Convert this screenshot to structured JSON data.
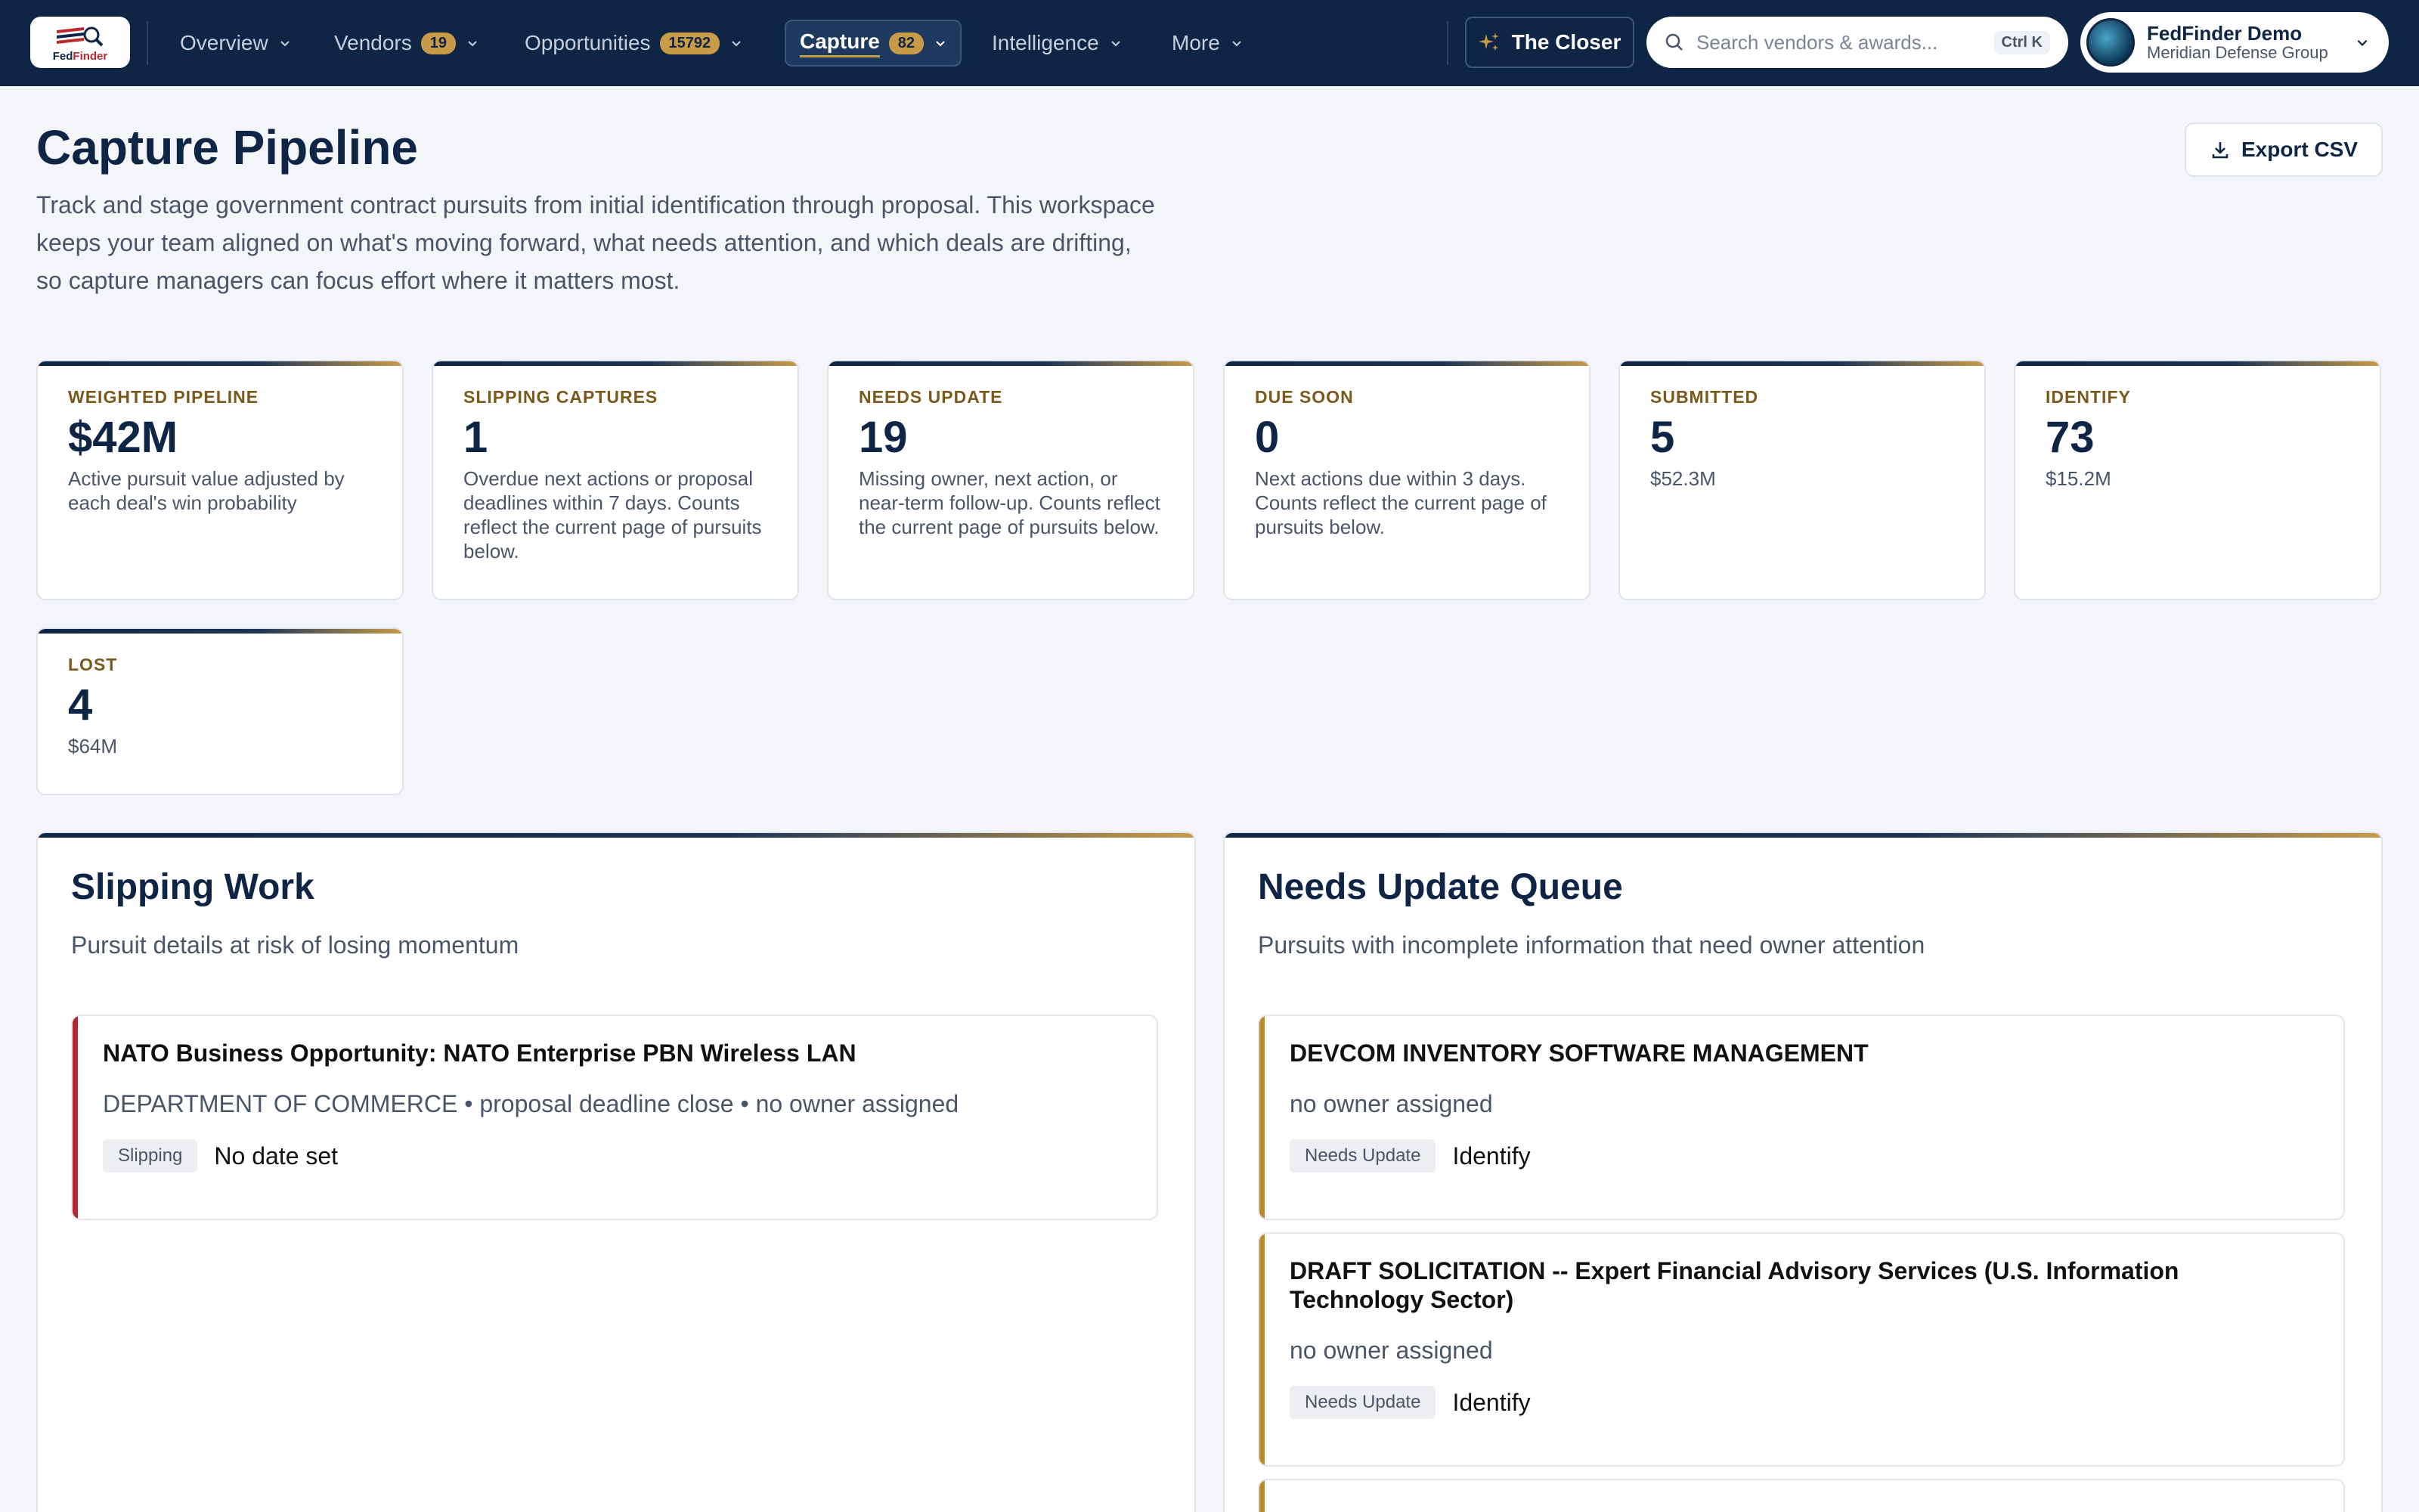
{
  "nav": {
    "logo_text_blue": "Fed",
    "logo_text_red": "Finder",
    "items": [
      {
        "label": "Overview"
      },
      {
        "label": "Vendors",
        "badge": "19"
      },
      {
        "label": "Opportunities",
        "badge": "15792"
      },
      {
        "label": "Capture",
        "badge": "82"
      },
      {
        "label": "Intelligence"
      },
      {
        "label": "More"
      }
    ],
    "closer_label": "The Closer",
    "search_placeholder": "Search vendors & awards...",
    "search_shortcut": "Ctrl K",
    "user_name": "FedFinder Demo",
    "user_org": "Meridian Defense Group"
  },
  "header": {
    "title": "Capture Pipeline",
    "description": "Track and stage government contract pursuits from initial identification through proposal. This workspace keeps your team aligned on what's moving forward, what needs attention, and which deals are drifting, so capture managers can focus effort where it matters most.",
    "export_label": "Export CSV"
  },
  "stats": [
    {
      "label": "WEIGHTED PIPELINE",
      "value": "$42M",
      "desc": "Active pursuit value adjusted by each deal's win probability"
    },
    {
      "label": "SLIPPING CAPTURES",
      "value": "1",
      "desc": "Overdue next actions or proposal deadlines within 7 days. Counts reflect the current page of pursuits below."
    },
    {
      "label": "NEEDS UPDATE",
      "value": "19",
      "desc": "Missing owner, next action, or near-term follow-up. Counts reflect the current page of pursuits below."
    },
    {
      "label": "DUE SOON",
      "value": "0",
      "desc": "Next actions due within 3 days. Counts reflect the current page of pursuits below."
    },
    {
      "label": "SUBMITTED",
      "value": "5",
      "desc": "$52.3M"
    },
    {
      "label": "IDENTIFY",
      "value": "73",
      "desc": "$15.2M"
    },
    {
      "label": "LOST",
      "value": "4",
      "desc": "$64M"
    }
  ],
  "slipping": {
    "title": "Slipping Work",
    "subtitle": "Pursuit details at risk of losing momentum",
    "items": [
      {
        "title": "NATO Business Opportunity: NATO Enterprise PBN Wireless LAN",
        "meta": "DEPARTMENT OF COMMERCE • proposal deadline close • no owner assigned",
        "tag": "Slipping",
        "value": "No date set"
      }
    ]
  },
  "needs_update": {
    "title": "Needs Update Queue",
    "subtitle": "Pursuits with incomplete information that need owner attention",
    "items": [
      {
        "title": "DEVCOM INVENTORY SOFTWARE MANAGEMENT",
        "meta": "no owner assigned",
        "tag": "Needs Update",
        "value": "Identify"
      },
      {
        "title": "DRAFT SOLICITATION -- Expert Financial Advisory Services (U.S. Information Technology Sector)",
        "meta": "no owner assigned",
        "tag": "Needs Update",
        "value": "Identify"
      }
    ]
  },
  "colors": {
    "navy": "#0e2545",
    "gold": "#c89b49",
    "slipping_accent": "#b3262b",
    "needs_update_accent": "#b98a2a"
  }
}
